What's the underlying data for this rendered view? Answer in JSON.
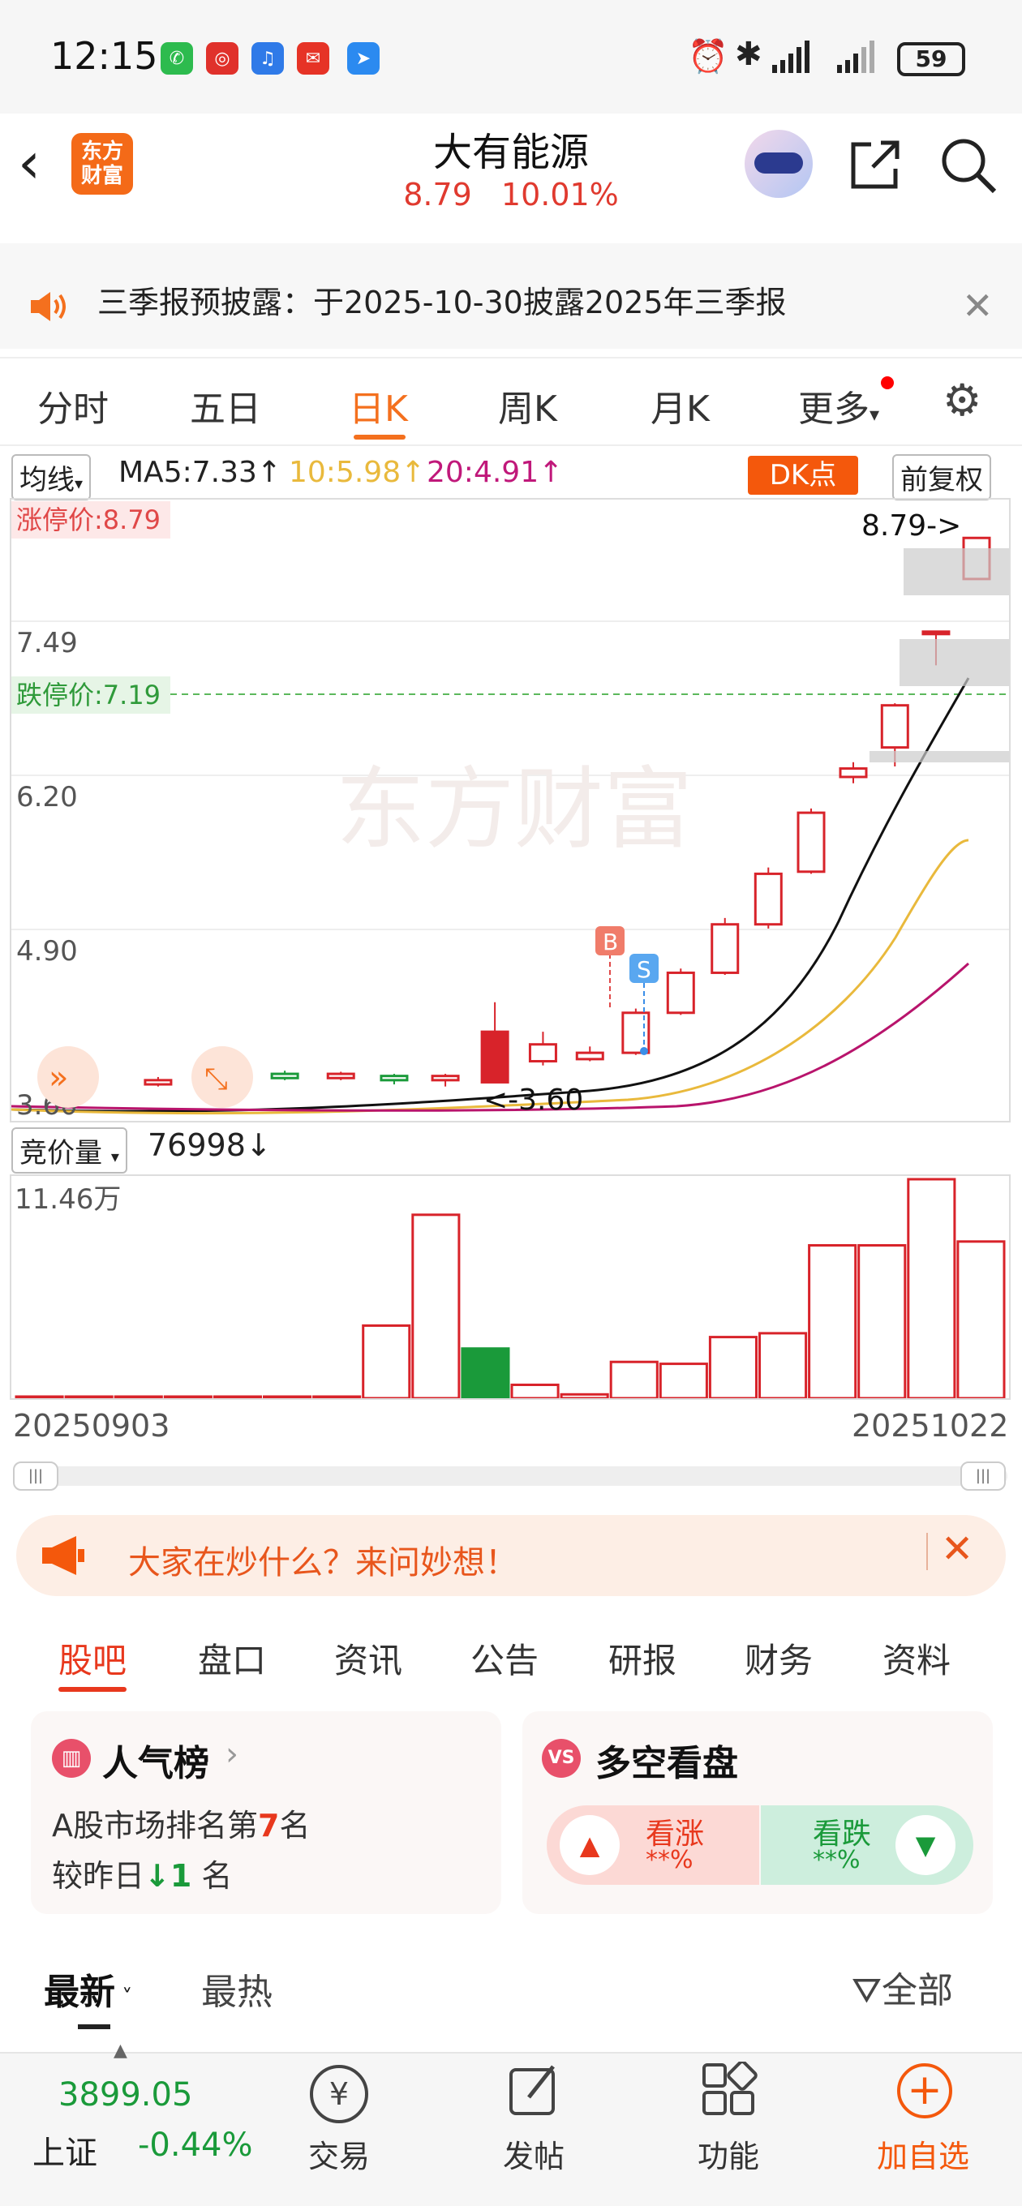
{
  "status_bar": {
    "time": "12:15",
    "battery": "59",
    "icons": [
      "wechat-icon",
      "netease-icon",
      "voice-icon",
      "weibo-icon",
      "dingtalk-icon",
      "alarm-icon",
      "bluetooth-icon",
      "signal-icon",
      "signal-icon"
    ]
  },
  "header": {
    "logo_text": "东方财富",
    "stock_name": "大有能源",
    "price": "8.79",
    "change_pct": "10.01%"
  },
  "notice": {
    "text": "三季报预披露：于2025-10-30披露2025年三季报"
  },
  "period_tabs": [
    "分时",
    "五日",
    "日K",
    "周K",
    "月K",
    "更多"
  ],
  "active_tab": "日K",
  "ma_legend": {
    "selector": "均线",
    "ma5": "MA5:7.33↑",
    "ma10": "10:5.98↑",
    "ma20": "20:4.91↑",
    "dk_button": "DK点",
    "adjust_button": "前复权"
  },
  "kline": {
    "limit_up_label": "涨停价:8.79",
    "limit_down_label": "跌停价:7.19",
    "y_labels": [
      "7.49",
      "6.20",
      "4.90",
      "3.60"
    ],
    "top_annotation": "8.79->",
    "low_annotation": "<-3.60",
    "buy_marker": "B",
    "sell_marker": "S",
    "watermark": "东方财富"
  },
  "volume": {
    "selector": "竞价量",
    "value": "76998↓",
    "max_label": "11.46万",
    "start_date": "20250903",
    "end_date": "20251022"
  },
  "chart_data": {
    "type": "candlestick",
    "ylim": [
      3.3,
      9.0
    ],
    "candles": [
      {
        "o": 3.58,
        "c": 3.62,
        "h": 3.65,
        "l": 3.56
      },
      {
        "o": 3.6,
        "c": 3.64,
        "h": 3.67,
        "l": 3.58
      },
      {
        "o": 3.62,
        "c": 3.72,
        "h": 3.74,
        "l": 3.6
      },
      {
        "o": 3.7,
        "c": 3.66,
        "h": 3.73,
        "l": 3.64
      },
      {
        "o": 3.66,
        "c": 3.7,
        "h": 3.72,
        "l": 3.64
      },
      {
        "o": 3.68,
        "c": 3.64,
        "h": 3.7,
        "l": 3.6
      },
      {
        "o": 3.64,
        "c": 3.68,
        "h": 3.7,
        "l": 3.58
      },
      {
        "o": 3.62,
        "c": 4.1,
        "h": 4.38,
        "l": 3.82
      },
      {
        "o": 3.82,
        "c": 3.98,
        "h": 4.1,
        "l": 3.78
      },
      {
        "o": 3.84,
        "c": 3.9,
        "h": 3.96,
        "l": 3.82
      },
      {
        "o": 3.9,
        "c": 4.28,
        "h": 4.32,
        "l": 3.88
      },
      {
        "o": 4.28,
        "c": 4.66,
        "h": 4.7,
        "l": 4.26
      },
      {
        "o": 4.66,
        "c": 5.12,
        "h": 5.18,
        "l": 4.64
      },
      {
        "o": 5.12,
        "c": 5.6,
        "h": 5.66,
        "l": 5.08
      },
      {
        "o": 5.62,
        "c": 6.18,
        "h": 6.22,
        "l": 5.6
      },
      {
        "o": 6.52,
        "c": 6.6,
        "h": 6.66,
        "l": 6.46
      },
      {
        "o": 6.8,
        "c": 7.2,
        "h": 7.22,
        "l": 6.62
      },
      {
        "o": 7.9,
        "c": 7.9,
        "h": 7.9,
        "l": 7.58
      },
      {
        "o": 8.4,
        "c": 8.79,
        "h": 8.79,
        "l": 8.4
      }
    ],
    "volumes": [
      0.02,
      0.01,
      0.03,
      0.02,
      0.02,
      0.01,
      0.01,
      3.8,
      9.6,
      2.6,
      0.7,
      0.2,
      1.9,
      1.8,
      3.2,
      3.4,
      8.0,
      8.0,
      11.46,
      8.2
    ]
  },
  "ai_bar": {
    "text": "大家在炒什么？来问妙想！"
  },
  "content_tabs": [
    "股吧",
    "盘口",
    "资讯",
    "公告",
    "研报",
    "财务",
    "资料"
  ],
  "popularity_card": {
    "title": "人气榜",
    "line1_prefix": "A股市场排名第",
    "rank": "7",
    "line1_suffix": "名",
    "line2_prefix": "较昨日",
    "line2_change": "↓1",
    "line2_suffix": " 名"
  },
  "sentiment_card": {
    "title": "多空看盘",
    "bull_label": "看涨",
    "bull_pct": "**%",
    "bear_label": "看跌",
    "bear_pct": "**%"
  },
  "feed_tabs": {
    "latest": "最新",
    "hot": "最热",
    "filter": "全部"
  },
  "bottom_bar": {
    "index_value": "3899.05",
    "index_name": "上证",
    "index_change": "-0.44%",
    "nav": [
      "交易",
      "发帖",
      "功能",
      "加自选"
    ]
  }
}
